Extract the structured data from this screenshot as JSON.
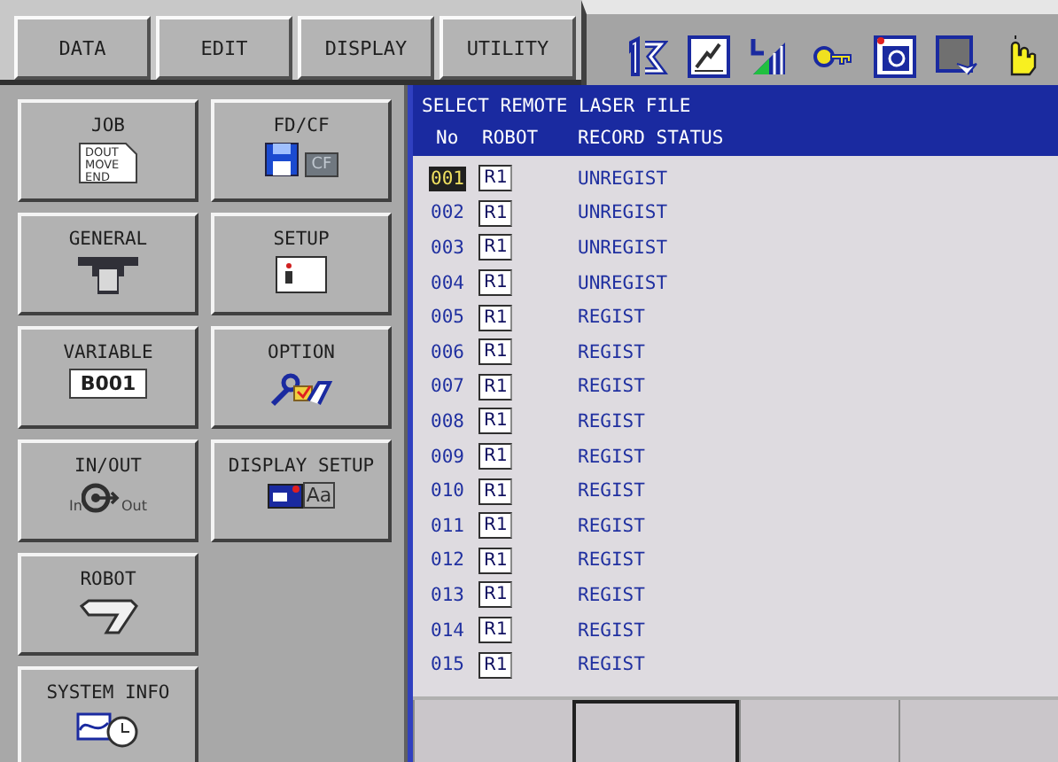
{
  "menu_tabs": [
    {
      "label": "DATA"
    },
    {
      "label": "EDIT"
    },
    {
      "label": "DISPLAY"
    },
    {
      "label": "UTILITY"
    }
  ],
  "main_menu": [
    {
      "label": "JOB",
      "kind": "job",
      "icon_text": [
        "DOUT",
        "MOVE",
        "END"
      ]
    },
    {
      "label": "FD/CF",
      "kind": "fdcf",
      "icon_text": [
        "CF"
      ]
    },
    {
      "label": "GENERAL",
      "kind": "general"
    },
    {
      "label": "SETUP",
      "kind": "setup"
    },
    {
      "label": "VARIABLE",
      "kind": "variable",
      "icon_text": [
        "B001"
      ]
    },
    {
      "label": "OPTION",
      "kind": "option"
    },
    {
      "label": "IN/OUT",
      "kind": "inout",
      "icon_text": [
        "In",
        "Out"
      ]
    },
    {
      "label": "DISPLAY SETUP",
      "kind": "display",
      "icon_text": [
        "Aa"
      ]
    },
    {
      "label": "ROBOT",
      "kind": "robot"
    },
    {
      "kind": "empty"
    },
    {
      "label": "SYSTEM INFO",
      "kind": "sysinfo"
    }
  ],
  "panel": {
    "title": "SELECT REMOTE LASER FILE",
    "columns": [
      "No",
      "ROBOT",
      "RECORD STATUS"
    ],
    "rows": [
      {
        "no": "001",
        "robot": "R1",
        "status": "UNREGIST",
        "selected": true
      },
      {
        "no": "002",
        "robot": "R1",
        "status": "UNREGIST",
        "selected": false
      },
      {
        "no": "003",
        "robot": "R1",
        "status": "UNREGIST",
        "selected": false
      },
      {
        "no": "004",
        "robot": "R1",
        "status": "UNREGIST",
        "selected": false
      },
      {
        "no": "005",
        "robot": "R1",
        "status": "REGIST",
        "selected": false
      },
      {
        "no": "006",
        "robot": "R1",
        "status": "REGIST",
        "selected": false
      },
      {
        "no": "007",
        "robot": "R1",
        "status": "REGIST",
        "selected": false
      },
      {
        "no": "008",
        "robot": "R1",
        "status": "REGIST",
        "selected": false
      },
      {
        "no": "009",
        "robot": "R1",
        "status": "REGIST",
        "selected": false
      },
      {
        "no": "010",
        "robot": "R1",
        "status": "REGIST",
        "selected": false
      },
      {
        "no": "011",
        "robot": "R1",
        "status": "REGIST",
        "selected": false
      },
      {
        "no": "012",
        "robot": "R1",
        "status": "REGIST",
        "selected": false
      },
      {
        "no": "013",
        "robot": "R1",
        "status": "REGIST",
        "selected": false
      },
      {
        "no": "014",
        "robot": "R1",
        "status": "REGIST",
        "selected": false
      },
      {
        "no": "015",
        "robot": "R1",
        "status": "REGIST",
        "selected": false
      }
    ]
  },
  "function_keys": [
    {
      "selected": false
    },
    {
      "selected": true
    },
    {
      "selected": false
    },
    {
      "selected": false
    }
  ]
}
